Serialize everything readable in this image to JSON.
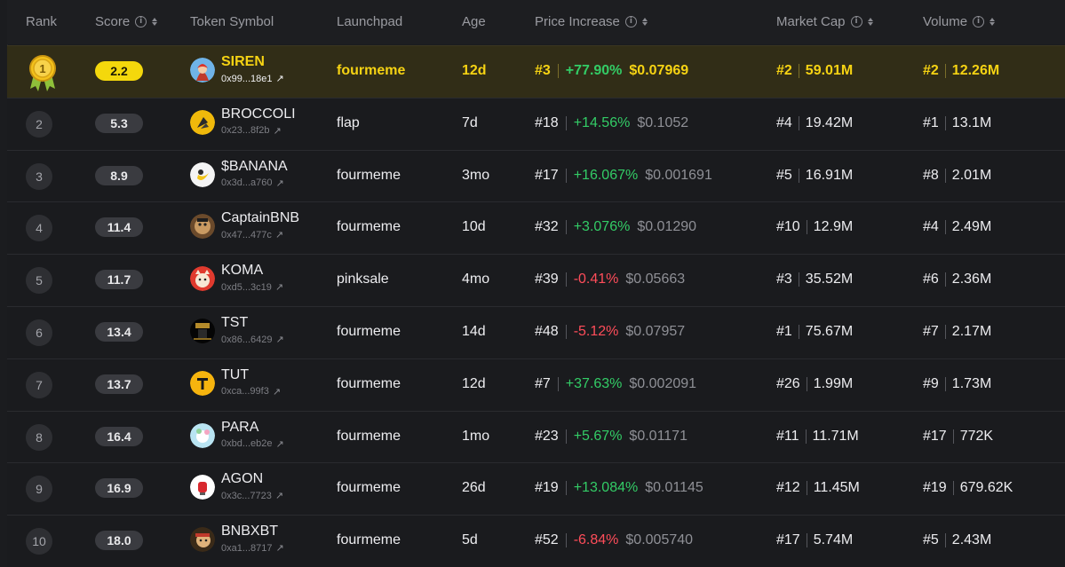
{
  "header": {
    "rank": "Rank",
    "score": "Score",
    "token_symbol": "Token Symbol",
    "launchpad": "Launchpad",
    "age": "Age",
    "price_increase": "Price Increase",
    "market_cap": "Market Cap",
    "volume": "Volume"
  },
  "colors": {
    "highlight": "#f6d313",
    "positive": "#33cc66",
    "negative": "#ff4d5a",
    "row_top_bg": "#312d17"
  },
  "rows": [
    {
      "rank": "1",
      "score": "2.2",
      "symbol": "SIREN",
      "address": "0x99...18e1",
      "launchpad": "fourmeme",
      "age": "12d",
      "price_rank": "#3",
      "change": "+77.90%",
      "direction": "up",
      "price": "$0.07969",
      "mc_rank": "#2",
      "market_cap": "59.01M",
      "vol_rank": "#2",
      "volume": "12.26M",
      "icon": "siren-avatar-icon"
    },
    {
      "rank": "2",
      "score": "5.3",
      "symbol": "BROCCOLI",
      "address": "0x23...8f2b",
      "launchpad": "flap",
      "age": "7d",
      "price_rank": "#18",
      "change": "+14.56%",
      "direction": "up",
      "price": "$0.1052",
      "mc_rank": "#4",
      "market_cap": "19.42M",
      "vol_rank": "#1",
      "volume": "13.1M",
      "icon": "broccoli-avatar-icon"
    },
    {
      "rank": "3",
      "score": "8.9",
      "symbol": "$BANANA",
      "address": "0x3d...a760",
      "launchpad": "fourmeme",
      "age": "3mo",
      "price_rank": "#17",
      "change": "+16.067%",
      "direction": "up",
      "price": "$0.001691",
      "mc_rank": "#5",
      "market_cap": "16.91M",
      "vol_rank": "#8",
      "volume": "2.01M",
      "icon": "banana-avatar-icon"
    },
    {
      "rank": "4",
      "score": "11.4",
      "symbol": "CaptainBNB",
      "address": "0x47...477c",
      "launchpad": "fourmeme",
      "age": "10d",
      "price_rank": "#32",
      "change": "+3.076%",
      "direction": "up",
      "price": "$0.01290",
      "mc_rank": "#10",
      "market_cap": "12.9M",
      "vol_rank": "#4",
      "volume": "2.49M",
      "icon": "captainbnb-avatar-icon"
    },
    {
      "rank": "5",
      "score": "11.7",
      "symbol": "KOMA",
      "address": "0xd5...3c19",
      "launchpad": "pinksale",
      "age": "4mo",
      "price_rank": "#39",
      "change": "-0.41%",
      "direction": "down",
      "price": "$0.05663",
      "mc_rank": "#3",
      "market_cap": "35.52M",
      "vol_rank": "#6",
      "volume": "2.36M",
      "icon": "koma-avatar-icon"
    },
    {
      "rank": "6",
      "score": "13.4",
      "symbol": "TST",
      "address": "0x86...6429",
      "launchpad": "fourmeme",
      "age": "14d",
      "price_rank": "#48",
      "change": "-5.12%",
      "direction": "down",
      "price": "$0.07957",
      "mc_rank": "#1",
      "market_cap": "75.67M",
      "vol_rank": "#7",
      "volume": "2.17M",
      "icon": "tst-avatar-icon"
    },
    {
      "rank": "7",
      "score": "13.7",
      "symbol": "TUT",
      "address": "0xca...99f3",
      "launchpad": "fourmeme",
      "age": "12d",
      "price_rank": "#7",
      "change": "+37.63%",
      "direction": "up",
      "price": "$0.002091",
      "mc_rank": "#26",
      "market_cap": "1.99M",
      "vol_rank": "#9",
      "volume": "1.73M",
      "icon": "tut-avatar-icon"
    },
    {
      "rank": "8",
      "score": "16.4",
      "symbol": "PARA",
      "address": "0xbd...eb2e",
      "launchpad": "fourmeme",
      "age": "1mo",
      "price_rank": "#23",
      "change": "+5.67%",
      "direction": "up",
      "price": "$0.01171",
      "mc_rank": "#11",
      "market_cap": "11.71M",
      "vol_rank": "#17",
      "volume": "772K",
      "icon": "para-avatar-icon"
    },
    {
      "rank": "9",
      "score": "16.9",
      "symbol": "AGON",
      "address": "0x3c...7723",
      "launchpad": "fourmeme",
      "age": "26d",
      "price_rank": "#19",
      "change": "+13.084%",
      "direction": "up",
      "price": "$0.01145",
      "mc_rank": "#12",
      "market_cap": "11.45M",
      "vol_rank": "#19",
      "volume": "679.62K",
      "icon": "agon-avatar-icon"
    },
    {
      "rank": "10",
      "score": "18.0",
      "symbol": "BNBXBT",
      "address": "0xa1...8717",
      "launchpad": "fourmeme",
      "age": "5d",
      "price_rank": "#52",
      "change": "-6.84%",
      "direction": "down",
      "price": "$0.005740",
      "mc_rank": "#17",
      "market_cap": "5.74M",
      "vol_rank": "#5",
      "volume": "2.43M",
      "icon": "bnbxbt-avatar-icon"
    }
  ]
}
